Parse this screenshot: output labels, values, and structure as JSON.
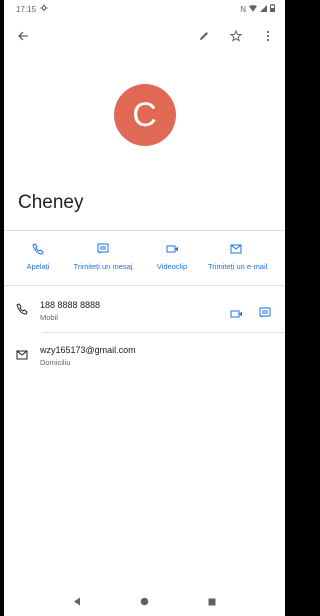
{
  "status_bar": {
    "time": "17:15"
  },
  "contact": {
    "avatar_letter": "C",
    "name": "Cheney"
  },
  "quick_actions": [
    {
      "label": "Apelați",
      "icon": "phone-icon"
    },
    {
      "label": "Trimiteți un mesaj",
      "icon": "message-icon"
    },
    {
      "label": "Videoclip",
      "icon": "video-icon"
    },
    {
      "label": "Trimiteți un e-mail",
      "icon": "email-icon"
    }
  ],
  "phone": {
    "number": "188 8888 8888",
    "type": "Mobil"
  },
  "email": {
    "address": "wzy165173@gmail.com",
    "type": "Domiciliu"
  },
  "colors": {
    "accent": "#1a73e8",
    "avatar": "#e06955"
  }
}
